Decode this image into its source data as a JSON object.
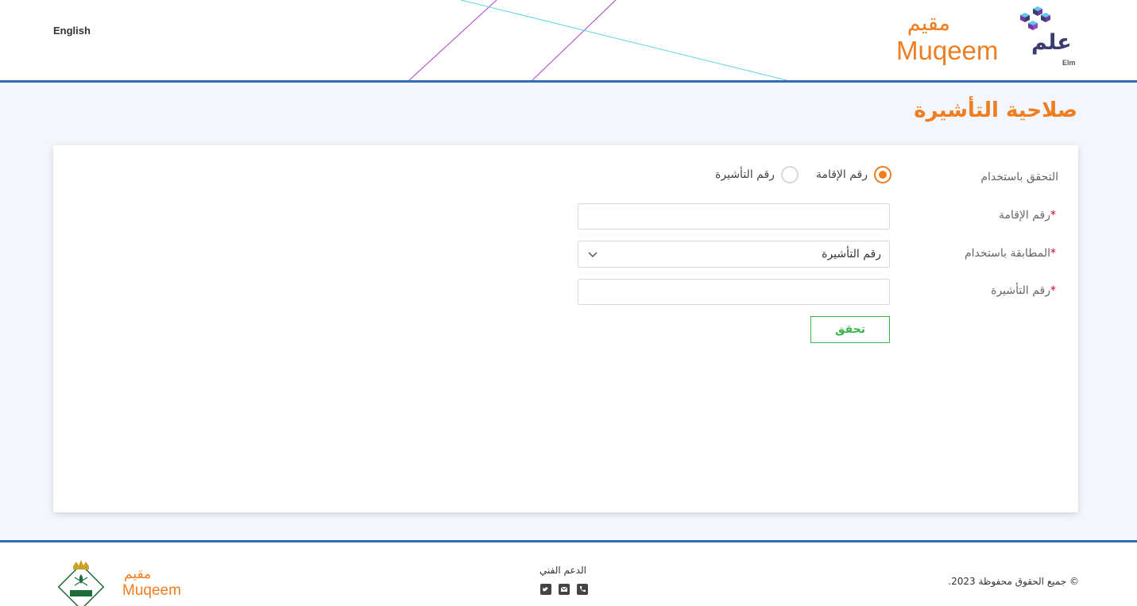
{
  "header": {
    "language_link": "English",
    "muqeem_logo_ar": "مقيم",
    "muqeem_logo_en": "Muqeem",
    "elm_logo_ar": "علم",
    "elm_logo_en": "Elm"
  },
  "page": {
    "title": "صلاحية التأشيرة"
  },
  "form": {
    "verify_using_label": "التحقق باستخدام",
    "radio_options": [
      {
        "label": "رقم الإقامة",
        "checked": true
      },
      {
        "label": "رقم التأشيرة",
        "checked": false
      }
    ],
    "iqama_label": "رقم الإقامة",
    "iqama_value": "",
    "match_label": "المطابقة باستخدام",
    "match_selected": "رقم التأشيرة",
    "visa_label": "رقم التأشيرة",
    "visa_value": "",
    "required_marker": "*",
    "verify_button": "تحقق"
  },
  "footer": {
    "copyright": "© جميع الحقوق محفوظة 2023.",
    "support_title": "الدعم الفني",
    "support_icons": [
      "twitter-icon",
      "email-icon",
      "phone-icon"
    ],
    "muqeem_logo_ar": "مقيم",
    "muqeem_logo_en": "Muqeem"
  },
  "colors": {
    "accent_orange": "#ef7d22",
    "header_border_blue": "#2f6fb5",
    "button_green": "#3ab54a",
    "required_red": "#d0021b",
    "elm_purple": "#3b3c6e"
  }
}
